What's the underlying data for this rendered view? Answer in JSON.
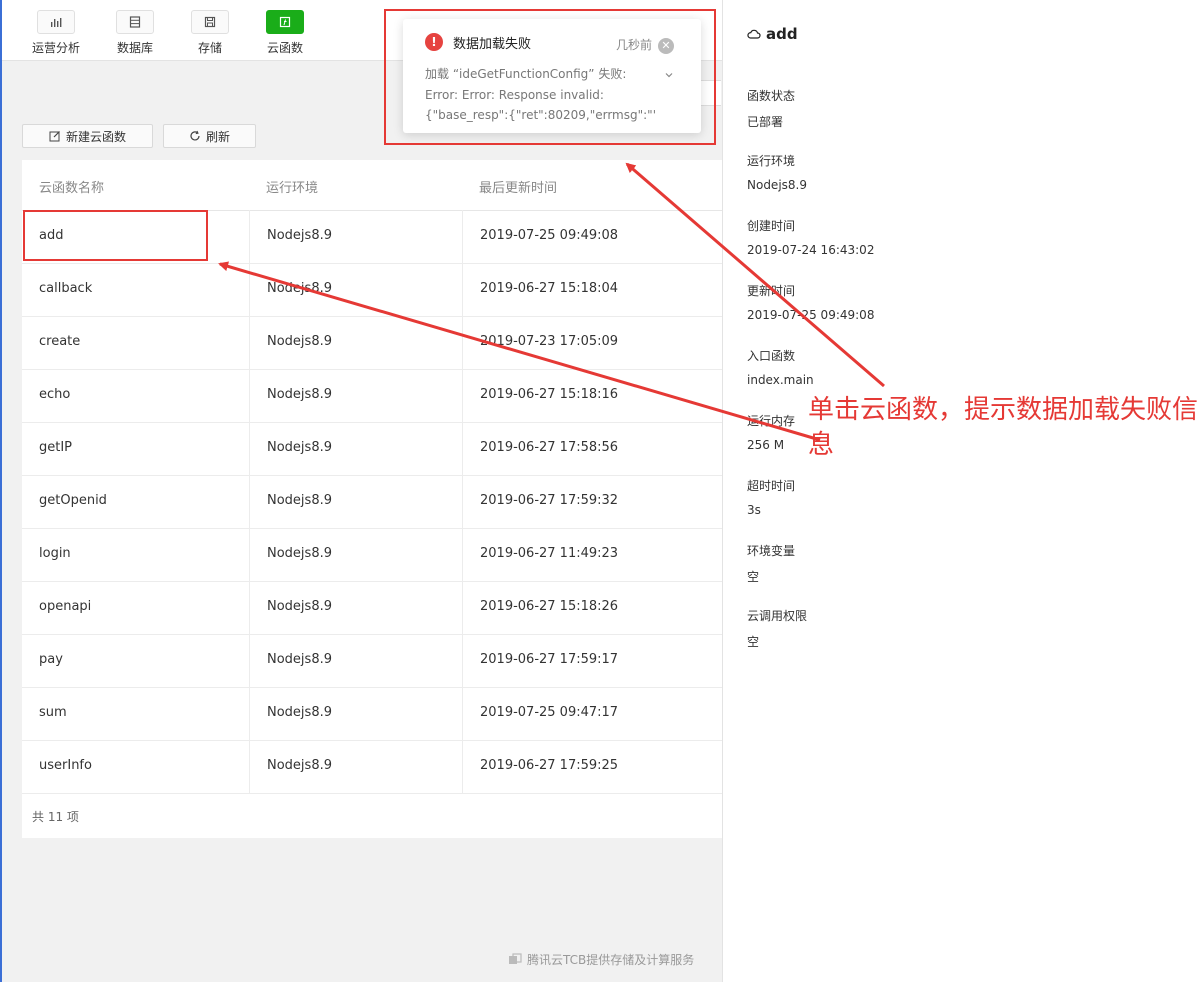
{
  "nav": {
    "items": [
      {
        "label": "运营分析",
        "icon": "chart-bars-icon",
        "active": false
      },
      {
        "label": "数据库",
        "icon": "database-icon",
        "active": false
      },
      {
        "label": "存储",
        "icon": "save-icon",
        "active": false
      },
      {
        "label": "云函数",
        "icon": "function-icon",
        "active": true
      }
    ]
  },
  "toolbar": {
    "new_function_label": "新建云函数",
    "refresh_label": "刷新"
  },
  "table": {
    "columns": [
      "云函数名称",
      "运行环境",
      "最后更新时间"
    ],
    "rows": [
      {
        "name": "add",
        "runtime": "Nodejs8.9",
        "updated": "2019-07-25 09:49:08"
      },
      {
        "name": "callback",
        "runtime": "Nodejs8.9",
        "updated": "2019-06-27 15:18:04"
      },
      {
        "name": "create",
        "runtime": "Nodejs8.9",
        "updated": "2019-07-23 17:05:09"
      },
      {
        "name": "echo",
        "runtime": "Nodejs8.9",
        "updated": "2019-06-27 15:18:16"
      },
      {
        "name": "getIP",
        "runtime": "Nodejs8.9",
        "updated": "2019-06-27 17:58:56"
      },
      {
        "name": "getOpenid",
        "runtime": "Nodejs8.9",
        "updated": "2019-06-27 17:59:32"
      },
      {
        "name": "login",
        "runtime": "Nodejs8.9",
        "updated": "2019-06-27 11:49:23"
      },
      {
        "name": "openapi",
        "runtime": "Nodejs8.9",
        "updated": "2019-06-27 15:18:26"
      },
      {
        "name": "pay",
        "runtime": "Nodejs8.9",
        "updated": "2019-06-27 17:59:17"
      },
      {
        "name": "sum",
        "runtime": "Nodejs8.9",
        "updated": "2019-07-25 09:47:17"
      },
      {
        "name": "userInfo",
        "runtime": "Nodejs8.9",
        "updated": "2019-06-27 17:59:25"
      }
    ],
    "total_label": "共 11 项"
  },
  "detail": {
    "title": "add",
    "fields": [
      {
        "label": "函数状态",
        "value": "已部署"
      },
      {
        "label": "运行环境",
        "value": "Nodejs8.9"
      },
      {
        "label": "创建时间",
        "value": "2019-07-24 16:43:02"
      },
      {
        "label": "更新时间",
        "value": "2019-07-25 09:49:08"
      },
      {
        "label": "入口函数",
        "value": "index.main"
      },
      {
        "label": "运行内存",
        "value": "256 M"
      },
      {
        "label": "超时时间",
        "value": "3s"
      },
      {
        "label": "环境变量",
        "value": "空"
      },
      {
        "label": "云调用权限",
        "value": "空"
      }
    ]
  },
  "toast": {
    "title": "数据加载失败",
    "time": "几秒前",
    "message_lines": [
      "加载 “ideGetFunctionConfig” 失败:",
      "Error: Error: Response invalid:",
      "{\"base_resp\":{\"ret\":80209,\"errmsg\":\"\"..."
    ]
  },
  "credit": "腾讯云TCB提供存储及计算服务",
  "annotation": "单击云函数，提示数据加载失败信息",
  "colors": {
    "accent": "#1aad19",
    "error": "#e64340",
    "annotation": "#e53935"
  }
}
